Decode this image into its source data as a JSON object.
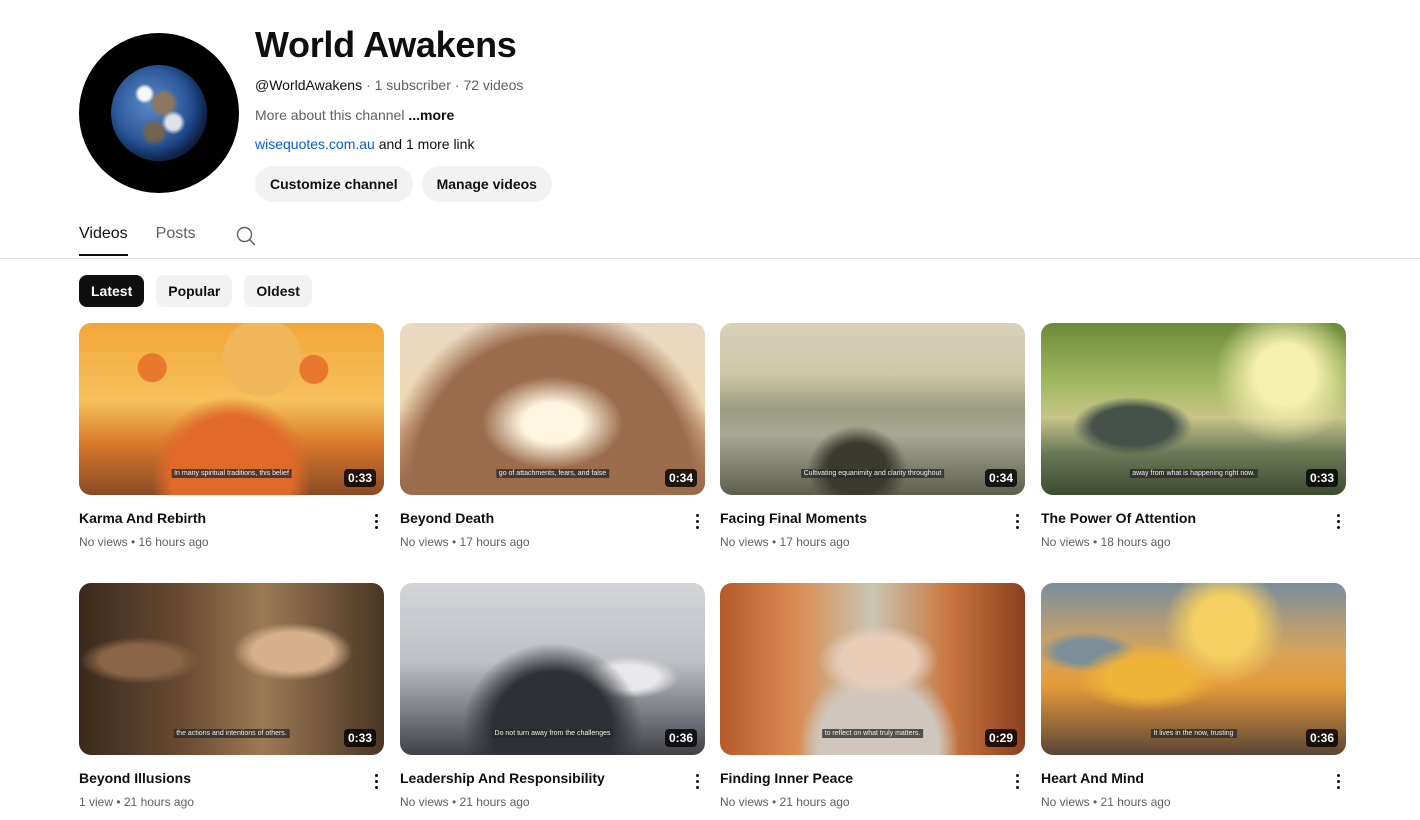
{
  "channel": {
    "title": "World Awakens",
    "handle": "@WorldAwakens",
    "subscribers": "· 1 subscriber",
    "videos_count": "· 72 videos",
    "description": "More about this channel",
    "more_label": "...more",
    "link_text": "wisequotes.com.au",
    "link_suffix": "and 1 more link",
    "customize_label": "Customize channel",
    "manage_label": "Manage videos"
  },
  "tabs": [
    {
      "label": "Videos",
      "active": true
    },
    {
      "label": "Posts",
      "active": false
    }
  ],
  "chips": [
    {
      "label": "Latest",
      "active": true
    },
    {
      "label": "Popular",
      "active": false
    },
    {
      "label": "Oldest",
      "active": false
    }
  ],
  "videos": [
    {
      "title": "Karma And Rebirth",
      "meta": "No views • 16 hours ago",
      "duration": "0:33",
      "caption": "In many spiritual traditions, this belief"
    },
    {
      "title": "Beyond Death",
      "meta": "No views • 17 hours ago",
      "duration": "0:34",
      "caption": "go of attachments, fears, and false"
    },
    {
      "title": "Facing Final Moments",
      "meta": "No views • 17 hours ago",
      "duration": "0:34",
      "caption": "Cultivating equanimity and clarity throughout"
    },
    {
      "title": "The Power Of Attention",
      "meta": "No views • 18 hours ago",
      "duration": "0:33",
      "caption": "away from what is happening right now."
    },
    {
      "title": "Beyond Illusions",
      "meta": "1 view • 21 hours ago",
      "duration": "0:33",
      "caption": "the actions and intentions of others."
    },
    {
      "title": "Leadership And Responsibility",
      "meta": "No views • 21 hours ago",
      "duration": "0:36",
      "caption": "Do not turn away from the challenges"
    },
    {
      "title": "Finding Inner Peace",
      "meta": "No views • 21 hours ago",
      "duration": "0:29",
      "caption": "to reflect on what truly matters."
    },
    {
      "title": "Heart And Mind",
      "meta": "No views • 21 hours ago",
      "duration": "0:36",
      "caption": "It lives in the now, trusting"
    }
  ]
}
